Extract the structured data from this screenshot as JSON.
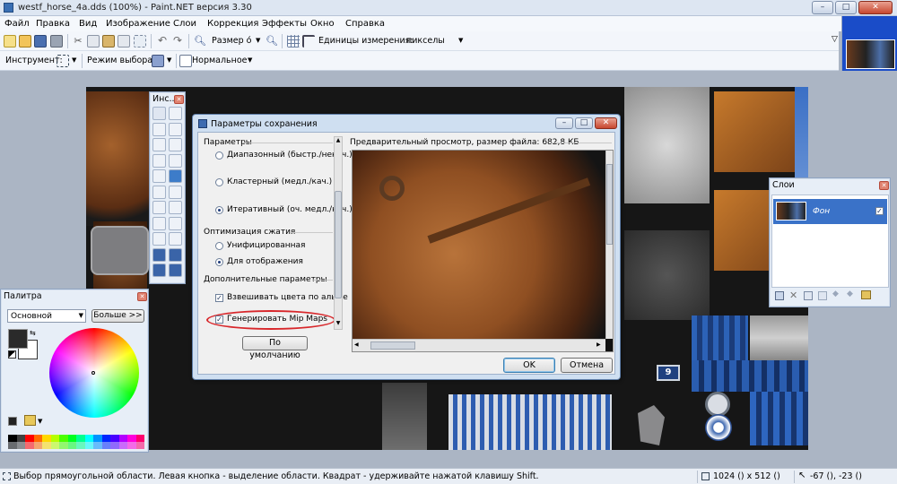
{
  "window": {
    "title": "westf_horse_4a.dds (100%) - Paint.NET версия 3.30",
    "minimize": "–",
    "maximize": "□",
    "close": "✕"
  },
  "menu": [
    "Файл",
    "Правка",
    "Вид",
    "Изображение",
    "Слои",
    "Коррекция",
    "Эффекты",
    "Окно",
    "Справка"
  ],
  "toolbar": {
    "zoom_label": "Размер о́",
    "units_label": "Единицы измерения:",
    "units_value": "пикселы"
  },
  "toolbar2": {
    "tool_label": "Инструмент:",
    "selection_mode_label": "Режим выбора:",
    "blend_mode_value": "Нормальное"
  },
  "tools_panel": {
    "title": "Инс...",
    "tools": [
      "rect-select",
      "move-selection",
      "lasso",
      "move-selection-outline",
      "ellipse-select",
      "zoom",
      "magic-wand",
      "pan",
      "paint-bucket",
      "gradient",
      "paintbrush",
      "eraser",
      "pencil",
      "color-picker",
      "clone-stamp",
      "recolor",
      "text",
      "line",
      "rectangle",
      "rounded-rectangle",
      "ellipse",
      "freeform-shape"
    ]
  },
  "palette_panel": {
    "title": "Палитра",
    "mode_value": "Основной",
    "more_button": "Больше >>",
    "primary_color": "#2a2a2a",
    "secondary_color": "#ffffff",
    "swatches": [
      "#000000",
      "#404040",
      "#ff0000",
      "#ff6a00",
      "#ffd800",
      "#b6ff00",
      "#4cff00",
      "#00ff21",
      "#00ff90",
      "#00ffff",
      "#0094ff",
      "#0026ff",
      "#4800ff",
      "#b200ff",
      "#ff00dc",
      "#ff006e"
    ]
  },
  "layers_panel": {
    "title": "Слои",
    "layer_name": "Фон",
    "layer_visible": "✓"
  },
  "dialog": {
    "title": "Параметры сохранения",
    "params_label": "Параметры",
    "options": [
      "Диапазонный (быстр./некач.)",
      "Кластерный (медл./кач.)",
      "Итеративный (оч. медл./кач.)"
    ],
    "compression_label": "Оптимизация сжатия",
    "compression_options": [
      "Унифицированная",
      "Для отображения"
    ],
    "extra_label": "Дополнительные параметры",
    "extra_options": [
      "Взвешивать цвета по альфе",
      "Генерировать Mip Maps"
    ],
    "defaults_button": "По умолчанию",
    "preview_label": "Предварительный просмотр, размер файла: 682,8 КБ",
    "ok_button": "OK",
    "cancel_button": "Отмена"
  },
  "texture": {
    "badge_number": "9"
  },
  "status": {
    "hint": "Выбор прямоугольной области. Левая кнопка - выделение области. Квадрат - удерживайте нажатой клавишу Shift.",
    "size": "1024 () x 512 ()",
    "coords": "-67 (), -23 ()"
  }
}
